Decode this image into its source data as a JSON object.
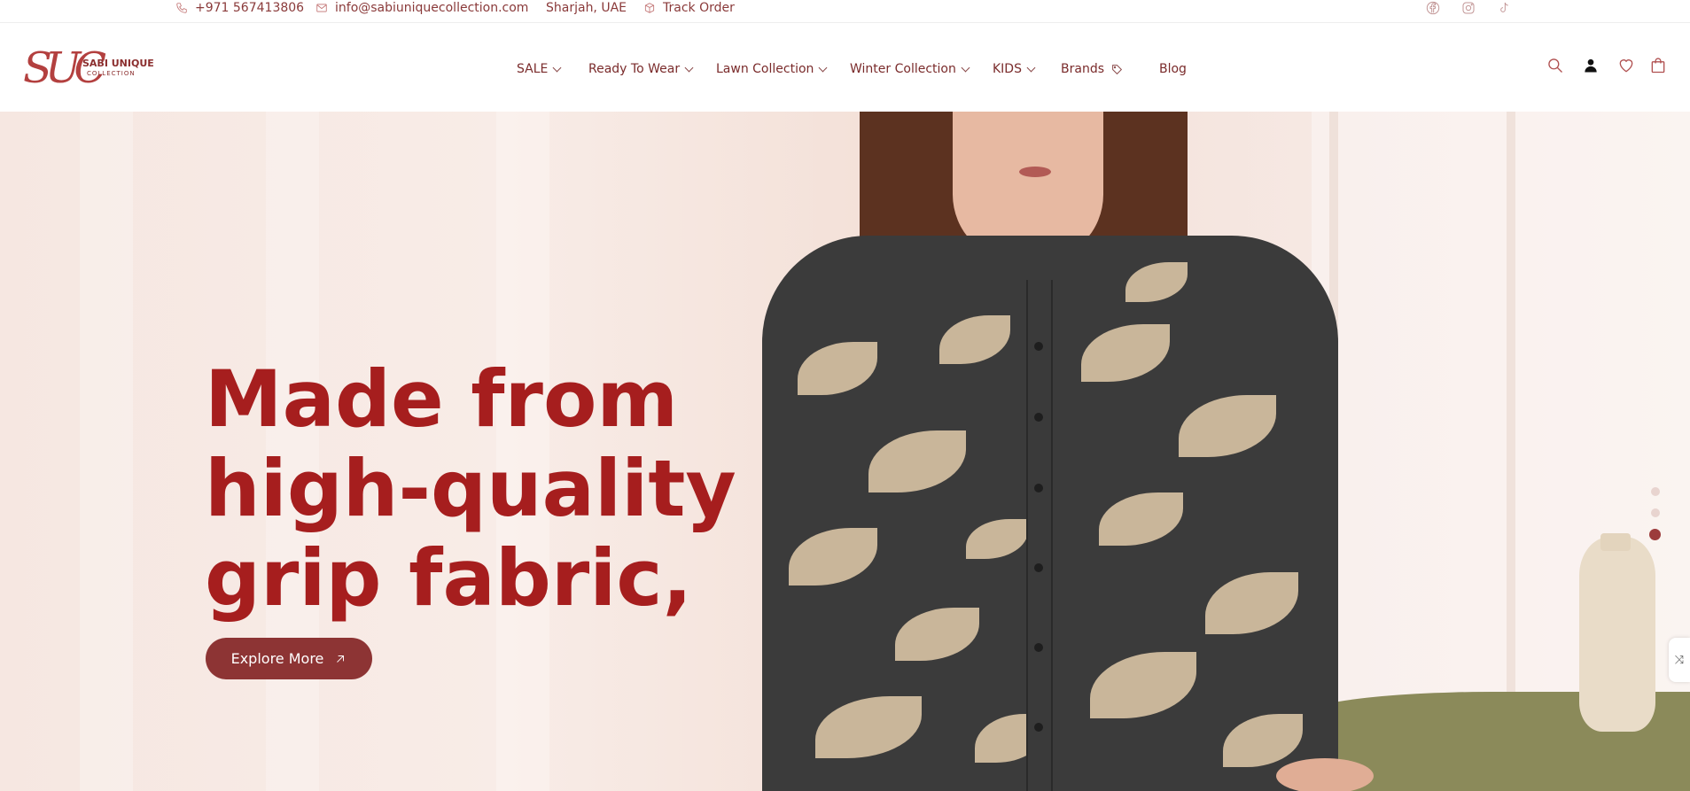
{
  "topbar": {
    "phone": "+971 567413806",
    "email": "info@sabiuniquecollection.com",
    "location": "Sharjah, UAE",
    "track_order": "Track Order",
    "social": [
      "facebook-icon",
      "instagram-icon",
      "tiktok-icon"
    ]
  },
  "logo": {
    "mark": "SUC",
    "name": "SABI UNIQUE",
    "sub": "COLLECTION"
  },
  "nav": {
    "items": [
      {
        "label": "SALE",
        "dropdown": true
      },
      {
        "label": "Ready To Wear",
        "dropdown": true
      },
      {
        "label": "Lawn Collection",
        "dropdown": true
      },
      {
        "label": "Winter Collection",
        "dropdown": true
      },
      {
        "label": "KIDS",
        "dropdown": true
      },
      {
        "label": "Brands",
        "dropdown": false
      },
      {
        "label": "Blog",
        "dropdown": false
      }
    ]
  },
  "header_icons": [
    "search-icon",
    "user-icon",
    "heart-icon",
    "bag-icon"
  ],
  "hero": {
    "headline_lines": [
      "Made from",
      "high-quality",
      "grip fabric,"
    ],
    "cta_label": "Explore More",
    "slide_count": 3,
    "active_slide": 3,
    "side_tab_glyph": "⤨"
  },
  "colors": {
    "brand": "#8d3434",
    "headline": "#a61e1e",
    "hero_bg": "#f6e7e1"
  }
}
